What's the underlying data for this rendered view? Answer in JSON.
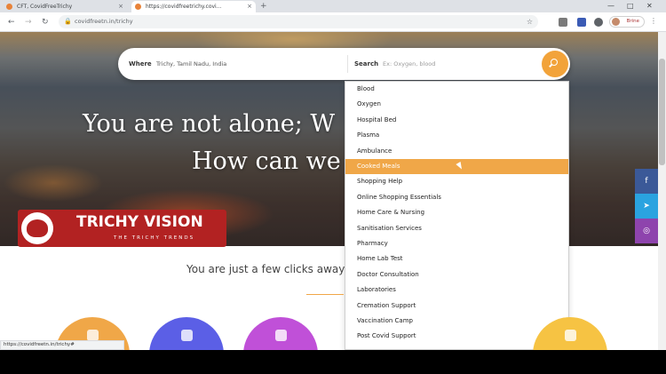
{
  "browser": {
    "tabs": [
      {
        "title": "CFT, CovidFreeTrichy",
        "active": false
      },
      {
        "title": "https://covidfreetrichy.covi...",
        "active": true
      }
    ],
    "url": "covidfreetn.in/trichy",
    "profile_label": "Brine",
    "status_url": "https://covidfreetn.in/trichy#"
  },
  "search": {
    "where_label": "Where",
    "where_value": "Trichy, Tamil Nadu, India",
    "search_label": "Search",
    "search_placeholder": "Ex: Oxygen, blood"
  },
  "hero": {
    "line1": "You are not alone; W",
    "line2": "How can we"
  },
  "dropdown": {
    "items": [
      "Blood",
      "Oxygen",
      "Hospital Bed",
      "Plasma",
      "Ambulance",
      "Cooked Meals",
      "Shopping Help",
      "Online Shopping Essentials",
      "Home Care & Nursing",
      "Sanitisation Services",
      "Pharmacy",
      "Home Lab Test",
      "Doctor Consultation",
      "Laboratories",
      "Cremation Support",
      "Vaccination Camp",
      "Post Covid Support"
    ],
    "highlighted": "Cooked Meals"
  },
  "logo": {
    "name": "TRICHY VISION",
    "subtitle": "THE TRICHY TRENDS"
  },
  "tagline": "You are just a few clicks away",
  "colors": {
    "accent": "#f0a748",
    "search_button": "#f2a33a",
    "logo_red": "#b22222",
    "facebook": "#3b5998",
    "telegram": "#2aa3e0",
    "instagram": "#8e44ad"
  },
  "social_icons": [
    "facebook-icon",
    "telegram-icon",
    "instagram-icon"
  ],
  "category_circles": [
    "#f0a748",
    "#5b5fe6",
    "#c050d8",
    "#f6c343"
  ]
}
